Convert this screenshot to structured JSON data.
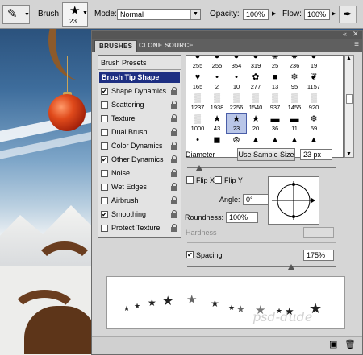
{
  "optionsBar": {
    "brush_label": "Brush:",
    "brush_size": "23",
    "mode_label": "Mode:",
    "mode_value": "Normal",
    "opacity_label": "Opacity:",
    "opacity_value": "100%",
    "flow_label": "Flow:",
    "flow_value": "100%"
  },
  "panel": {
    "tabs": [
      "BRUSHES",
      "CLONE SOURCE"
    ],
    "brush_presets": "Brush Presets",
    "brush_tip_shape": "Brush Tip Shape",
    "options": [
      {
        "label": "Shape Dynamics",
        "checked": true
      },
      {
        "label": "Scattering",
        "checked": false
      },
      {
        "label": "Texture",
        "checked": false
      },
      {
        "label": "Dual Brush",
        "checked": false
      },
      {
        "label": "Color Dynamics",
        "checked": false
      },
      {
        "label": "Other Dynamics",
        "checked": true
      },
      {
        "label": "Noise",
        "checked": false
      },
      {
        "label": "Wet Edges",
        "checked": false
      },
      {
        "label": "Airbrush",
        "checked": false
      },
      {
        "label": "Smoothing",
        "checked": true
      },
      {
        "label": "Protect Texture",
        "checked": false
      }
    ],
    "brush_grid": [
      {
        "size": "255",
        "shape": "blob"
      },
      {
        "size": "255",
        "shape": "blob"
      },
      {
        "size": "354",
        "shape": "blob"
      },
      {
        "size": "319",
        "shape": "blob"
      },
      {
        "size": "25",
        "shape": "swirl"
      },
      {
        "size": "236",
        "shape": "spark"
      },
      {
        "size": "19",
        "shape": "blob"
      },
      {
        "size": "",
        "shape": "blank"
      },
      {
        "size": "165",
        "shape": "heart"
      },
      {
        "size": "2",
        "shape": "dot"
      },
      {
        "size": "10",
        "shape": "dot"
      },
      {
        "size": "277",
        "shape": "flower"
      },
      {
        "size": "13",
        "shape": "square"
      },
      {
        "size": "95",
        "shape": "snowflake"
      },
      {
        "size": "1157",
        "shape": "leaf"
      },
      {
        "size": "",
        "shape": "blank"
      },
      {
        "size": "1237",
        "shape": "texture"
      },
      {
        "size": "1938",
        "shape": "texture"
      },
      {
        "size": "2256",
        "shape": "texture"
      },
      {
        "size": "1540",
        "shape": "texture"
      },
      {
        "size": "937",
        "shape": "texture"
      },
      {
        "size": "1455",
        "shape": "texture"
      },
      {
        "size": "920",
        "shape": "texture"
      },
      {
        "size": "",
        "shape": "blank"
      },
      {
        "size": "1000",
        "shape": "texture"
      },
      {
        "size": "43",
        "shape": "star"
      },
      {
        "size": "23",
        "shape": "star"
      },
      {
        "size": "20",
        "shape": "star"
      },
      {
        "size": "36",
        "shape": "dash"
      },
      {
        "size": "11",
        "shape": "dash"
      },
      {
        "size": "59",
        "shape": "snowflake"
      },
      {
        "size": "",
        "shape": "blank"
      },
      {
        "size": "",
        "shape": "dot"
      },
      {
        "size": "",
        "shape": "dark"
      },
      {
        "size": "",
        "shape": "wheel"
      },
      {
        "size": "",
        "shape": "tree"
      },
      {
        "size": "",
        "shape": "tree"
      },
      {
        "size": "",
        "shape": "tree"
      },
      {
        "size": "",
        "shape": "tree"
      },
      {
        "size": "",
        "shape": "blank"
      }
    ],
    "selected_index": 26,
    "diameter_label": "Diameter",
    "use_sample_size": "Use Sample Size",
    "diameter_value": "23 px",
    "diameter_fraction": 0.08,
    "flip_x": "Flip X",
    "flip_y": "Flip Y",
    "angle_label": "Angle:",
    "angle_value": "0°",
    "roundness_label": "Roundness:",
    "roundness_value": "100%",
    "hardness_label": "Hardness",
    "spacing_label": "Spacing",
    "spacing_checked": true,
    "spacing_value": "175%",
    "spacing_fraction": 0.7
  },
  "icons": {
    "brush_tool": "brush-icon",
    "airbrush": "airbrush-icon",
    "new_preset": "new-preset-icon",
    "delete": "trash-icon"
  }
}
